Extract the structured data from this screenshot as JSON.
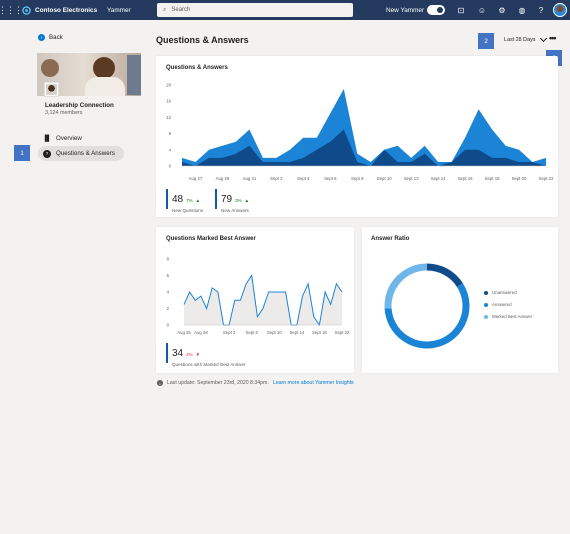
{
  "topbar": {
    "brand": "Contoso Electronics",
    "app": "Yammer",
    "search_placeholder": "Search",
    "new_yammer": "New Yammer",
    "icons": [
      "waffle-icon",
      "megaphone-icon",
      "emoji-icon",
      "settings-icon",
      "globe-icon",
      "help-icon"
    ],
    "bg": "#243a5e"
  },
  "sidebar": {
    "back": "Back",
    "group_name": "Leadership Connection",
    "members": "3,124 members",
    "nav": [
      {
        "label": "Overview"
      },
      {
        "label": "Questions & Answers"
      }
    ]
  },
  "callouts": [
    "1",
    "2",
    "3"
  ],
  "page": {
    "title": "Questions & Answers",
    "range": "Last 28 Days",
    "more": "•••"
  },
  "qa": {
    "title": "Questions & Answers",
    "kpis": [
      {
        "value": "48",
        "pct": "7%",
        "label": "New Questions"
      },
      {
        "value": "79",
        "pct": "3%",
        "label": "New Answers"
      }
    ]
  },
  "best": {
    "title": "Questions Marked Best Answer",
    "kpi": {
      "value": "34",
      "pct": "2%",
      "label": "Questions with Marked Best Answer"
    }
  },
  "ratio": {
    "title": "Answer Ratio",
    "legend": [
      {
        "label": "Unanswered",
        "color": "#0f4a8a"
      },
      {
        "label": "Answered",
        "color": "#1b84d6"
      },
      {
        "label": "Marked Best Answer",
        "color": "#6fb6ea"
      }
    ]
  },
  "footer": {
    "text": "Last update: September 23rd, 2020 8:34pm.",
    "link": "Learn more about Yammer Insights"
  },
  "chart_data": [
    {
      "type": "area",
      "title": "Questions & Answers",
      "ylim": [
        0,
        20
      ],
      "yticks": [
        0,
        4,
        8,
        12,
        16,
        20
      ],
      "xticklabels": [
        "Aug 27",
        "Aug 29",
        "Aug 31",
        "Sept 2",
        "Sept 4",
        "Sept 6",
        "Sept 8",
        "Sept 10",
        "Sept 12",
        "Sept 14",
        "Sept 16",
        "Sept 18",
        "Sept 20",
        "Sept 22"
      ],
      "x": [
        "Aug 26",
        "Aug 27",
        "Aug 28",
        "Aug 29",
        "Aug 30",
        "Aug 31",
        "Sept 1",
        "Sept 2",
        "Sept 3",
        "Sept 4",
        "Sept 5",
        "Sept 6",
        "Sept 7",
        "Sept 8",
        "Sept 9",
        "Sept 10",
        "Sept 11",
        "Sept 12",
        "Sept 13",
        "Sept 14",
        "Sept 15",
        "Sept 16",
        "Sept 17",
        "Sept 18",
        "Sept 19",
        "Sept 20",
        "Sept 21",
        "Sept 22"
      ],
      "series": [
        {
          "color": "#1b84d6",
          "values": [
            2,
            1,
            4,
            5,
            6,
            9,
            2,
            2,
            4,
            7,
            7,
            13,
            19,
            3,
            1,
            4,
            5,
            2,
            5,
            1,
            1,
            7,
            14,
            9,
            5,
            4,
            1,
            2
          ]
        },
        {
          "color": "#0f4a8a",
          "values": [
            1,
            0,
            2,
            2,
            3,
            5,
            1,
            1,
            1,
            2,
            4,
            6,
            9,
            1,
            0,
            4,
            1,
            1,
            3,
            0,
            1,
            4,
            4,
            2,
            2,
            1,
            1,
            0
          ]
        }
      ]
    },
    {
      "type": "line",
      "title": "Questions Marked Best Answer",
      "ylim": [
        0,
        8
      ],
      "yticks": [
        0,
        2,
        4,
        6,
        8
      ],
      "xticklabels": [
        "Aug 25",
        "Aug 28",
        "Sept 2",
        "Sept 6",
        "Sept 10",
        "Sept 14",
        "Sept 18",
        "Sept 22"
      ],
      "x": [
        "Aug 25",
        "Aug 26",
        "Aug 27",
        "Aug 28",
        "Aug 29",
        "Aug 30",
        "Aug 31",
        "Sept 1",
        "Sept 2",
        "Sept 3",
        "Sept 4",
        "Sept 5",
        "Sept 6",
        "Sept 7",
        "Sept 8",
        "Sept 9",
        "Sept 10",
        "Sept 11",
        "Sept 12",
        "Sept 13",
        "Sept 14",
        "Sept 15",
        "Sept 16",
        "Sept 17",
        "Sept 18",
        "Sept 19",
        "Sept 20",
        "Sept 21",
        "Sept 22"
      ],
      "series": [
        {
          "color": "#1b84d6",
          "values": [
            2.5,
            4,
            3,
            3.5,
            2,
            4.5,
            4,
            0,
            0,
            3,
            3,
            5,
            6,
            1,
            2,
            4,
            4,
            4,
            4,
            0,
            0,
            3.5,
            5,
            1,
            0,
            4,
            2.5,
            5,
            4
          ]
        }
      ]
    },
    {
      "type": "pie",
      "title": "Answer Ratio",
      "labels": [
        "Unanswered",
        "Answered",
        "Marked Best Answer"
      ],
      "values": [
        16,
        58,
        26
      ],
      "colors": [
        "#0f4a8a",
        "#1b84d6",
        "#6fb6ea"
      ]
    }
  ]
}
